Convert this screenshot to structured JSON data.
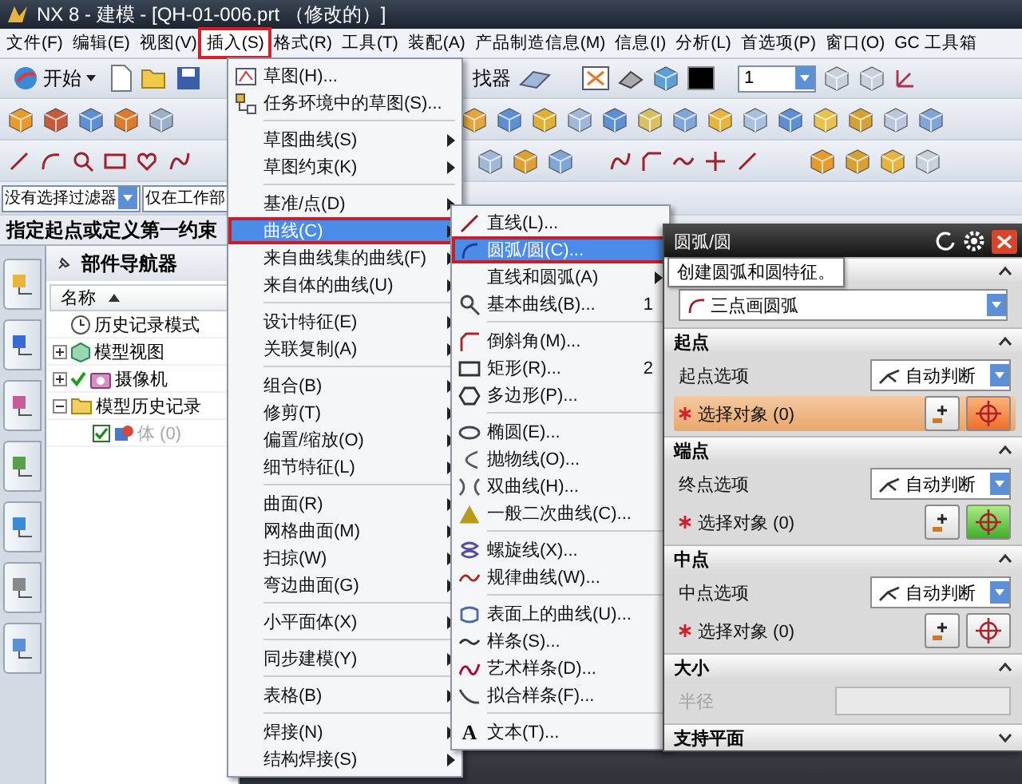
{
  "window": {
    "title": "NX 8 - 建模 - [QH-01-006.prt （修改的）]"
  },
  "menubar": [
    {
      "label": "文件(F)",
      "selected": false
    },
    {
      "label": "编辑(E)",
      "selected": false
    },
    {
      "label": "视图(V)",
      "selected": false
    },
    {
      "label": "插入(S)",
      "selected": true
    },
    {
      "label": "格式(R)",
      "selected": false
    },
    {
      "label": "工具(T)",
      "selected": false
    },
    {
      "label": "装配(A)",
      "selected": false
    },
    {
      "label": "产品制造信息(M)",
      "selected": false
    },
    {
      "label": "信息(I)",
      "selected": false
    },
    {
      "label": "分析(L)",
      "selected": false
    },
    {
      "label": "首选项(P)",
      "selected": false
    },
    {
      "label": "窗口(O)",
      "selected": false
    },
    {
      "label": "GC 工具箱",
      "selected": false
    }
  ],
  "toolbar": {
    "start_button": "开始",
    "command_finder": "找器",
    "layer": "1"
  },
  "selection_bar": {
    "filter": "没有选择过滤器",
    "scope": "仅在工作部"
  },
  "cue_line": "指定起点或定义第一约束",
  "navigator": {
    "title": "部件导航器",
    "column": "名称",
    "tree": [
      {
        "label": "历史记录模式",
        "kind": "mode",
        "checked": false
      },
      {
        "label": "模型视图",
        "kind": "views",
        "expanded": false,
        "checked": false
      },
      {
        "label": "摄像机",
        "kind": "cameras",
        "expanded": false,
        "checked": true
      },
      {
        "label": "模型历史记录",
        "kind": "folder",
        "expanded": true,
        "checked": false,
        "children": [
          {
            "label": "体 (0)",
            "kind": "body",
            "checked": true,
            "disabled": true
          }
        ]
      }
    ]
  },
  "insert_menu": {
    "items": [
      {
        "kind": "item",
        "label": "草图(H)...",
        "submenu": false,
        "selected": false
      },
      {
        "kind": "item",
        "label": "任务环境中的草图(S)...",
        "submenu": false,
        "selected": false
      },
      {
        "kind": "separator"
      },
      {
        "kind": "item",
        "label": "草图曲线(S)",
        "submenu": true,
        "selected": false
      },
      {
        "kind": "item",
        "label": "草图约束(K)",
        "submenu": true,
        "selected": false
      },
      {
        "kind": "separator"
      },
      {
        "kind": "item",
        "label": "基准/点(D)",
        "submenu": true,
        "selected": false
      },
      {
        "kind": "item",
        "label": "曲线(C)",
        "submenu": true,
        "selected": true
      },
      {
        "kind": "item",
        "label": "来自曲线集的曲线(F)",
        "submenu": true,
        "selected": false
      },
      {
        "kind": "item",
        "label": "来自体的曲线(U)",
        "submenu": true,
        "selected": false
      },
      {
        "kind": "separator"
      },
      {
        "kind": "item",
        "label": "设计特征(E)",
        "submenu": true,
        "selected": false
      },
      {
        "kind": "item",
        "label": "关联复制(A)",
        "submenu": true,
        "selected": false
      },
      {
        "kind": "separator"
      },
      {
        "kind": "item",
        "label": "组合(B)",
        "submenu": true,
        "selected": false
      },
      {
        "kind": "item",
        "label": "修剪(T)",
        "submenu": true,
        "selected": false
      },
      {
        "kind": "item",
        "label": "偏置/缩放(O)",
        "submenu": true,
        "selected": false
      },
      {
        "kind": "item",
        "label": "细节特征(L)",
        "submenu": true,
        "selected": false
      },
      {
        "kind": "separator"
      },
      {
        "kind": "item",
        "label": "曲面(R)",
        "submenu": true,
        "selected": false
      },
      {
        "kind": "item",
        "label": "网格曲面(M)",
        "submenu": true,
        "selected": false
      },
      {
        "kind": "item",
        "label": "扫掠(W)",
        "submenu": true,
        "selected": false
      },
      {
        "kind": "item",
        "label": "弯边曲面(G)",
        "submenu": true,
        "selected": false
      },
      {
        "kind": "separator"
      },
      {
        "kind": "item",
        "label": "小平面体(X)",
        "submenu": true,
        "selected": false
      },
      {
        "kind": "separator"
      },
      {
        "kind": "item",
        "label": "同步建模(Y)",
        "submenu": true,
        "selected": false
      },
      {
        "kind": "separator"
      },
      {
        "kind": "item",
        "label": "表格(B)",
        "submenu": true,
        "selected": false
      },
      {
        "kind": "separator"
      },
      {
        "kind": "item",
        "label": "焊接(N)",
        "submenu": true,
        "selected": false
      },
      {
        "kind": "item",
        "label": "结构焊接(S)",
        "submenu": true,
        "selected": false
      }
    ]
  },
  "curve_menu": {
    "items": [
      {
        "kind": "item",
        "label": "直线(L)...",
        "submenu": false,
        "selected": false
      },
      {
        "kind": "item",
        "label": "圆弧/圆(C)...",
        "submenu": false,
        "selected": true
      },
      {
        "kind": "item",
        "label": "直线和圆弧(A)",
        "submenu": true,
        "selected": false
      },
      {
        "kind": "item",
        "label": "基本曲线(B)...",
        "shortcut": "1",
        "submenu": false,
        "selected": false
      },
      {
        "kind": "separator"
      },
      {
        "kind": "item",
        "label": "倒斜角(M)...",
        "submenu": false,
        "selected": false
      },
      {
        "kind": "item",
        "label": "矩形(R)...",
        "shortcut": "2",
        "submenu": false,
        "selected": false
      },
      {
        "kind": "item",
        "label": "多边形(P)...",
        "submenu": false,
        "selected": false
      },
      {
        "kind": "separator"
      },
      {
        "kind": "item",
        "label": "椭圆(E)...",
        "submenu": false,
        "selected": false
      },
      {
        "kind": "item",
        "label": "抛物线(O)...",
        "submenu": false,
        "selected": false
      },
      {
        "kind": "item",
        "label": "双曲线(H)...",
        "submenu": false,
        "selected": false
      },
      {
        "kind": "item",
        "label": "一般二次曲线(C)...",
        "submenu": false,
        "selected": false
      },
      {
        "kind": "separator"
      },
      {
        "kind": "item",
        "label": "螺旋线(X)...",
        "submenu": false,
        "selected": false
      },
      {
        "kind": "item",
        "label": "规律曲线(W)...",
        "submenu": false,
        "selected": false
      },
      {
        "kind": "separator"
      },
      {
        "kind": "item",
        "label": "表面上的曲线(U)...",
        "submenu": false,
        "selected": false
      },
      {
        "kind": "item",
        "label": "样条(S)...",
        "submenu": false,
        "selected": false
      },
      {
        "kind": "item",
        "label": "艺术样条(D)...",
        "submenu": false,
        "selected": false
      },
      {
        "kind": "item",
        "label": "拟合样条(F)...",
        "submenu": false,
        "selected": false
      },
      {
        "kind": "separator"
      },
      {
        "kind": "item",
        "label": "文本(T)...",
        "glyph": "A",
        "submenu": false,
        "selected": false
      }
    ]
  },
  "dialog": {
    "title": "圆弧/圆",
    "tooltip": "创建圆弧和圆特征。",
    "type": {
      "value": "三点画圆弧",
      "expanded": true
    },
    "sections": [
      {
        "kind": "point",
        "title": "起点",
        "expanded": true,
        "option_label": "起点选项",
        "option_value": "自动判断",
        "select_label": "选择对象 (0)",
        "required": true,
        "active": true,
        "complete": false
      },
      {
        "kind": "point",
        "title": "端点",
        "expanded": true,
        "option_label": "终点选项",
        "option_value": "自动判断",
        "select_label": "选择对象 (0)",
        "required": true,
        "active": false,
        "complete": true
      },
      {
        "kind": "point",
        "title": "中点",
        "expanded": true,
        "option_label": "中点选项",
        "option_value": "自动判断",
        "select_label": "选择对象 (0)",
        "required": true,
        "active": false,
        "complete": false
      },
      {
        "kind": "size",
        "title": "大小",
        "expanded": true,
        "field_label": "半径",
        "disabled": true
      },
      {
        "kind": "plane",
        "title": "支持平面",
        "expanded": false
      }
    ]
  }
}
